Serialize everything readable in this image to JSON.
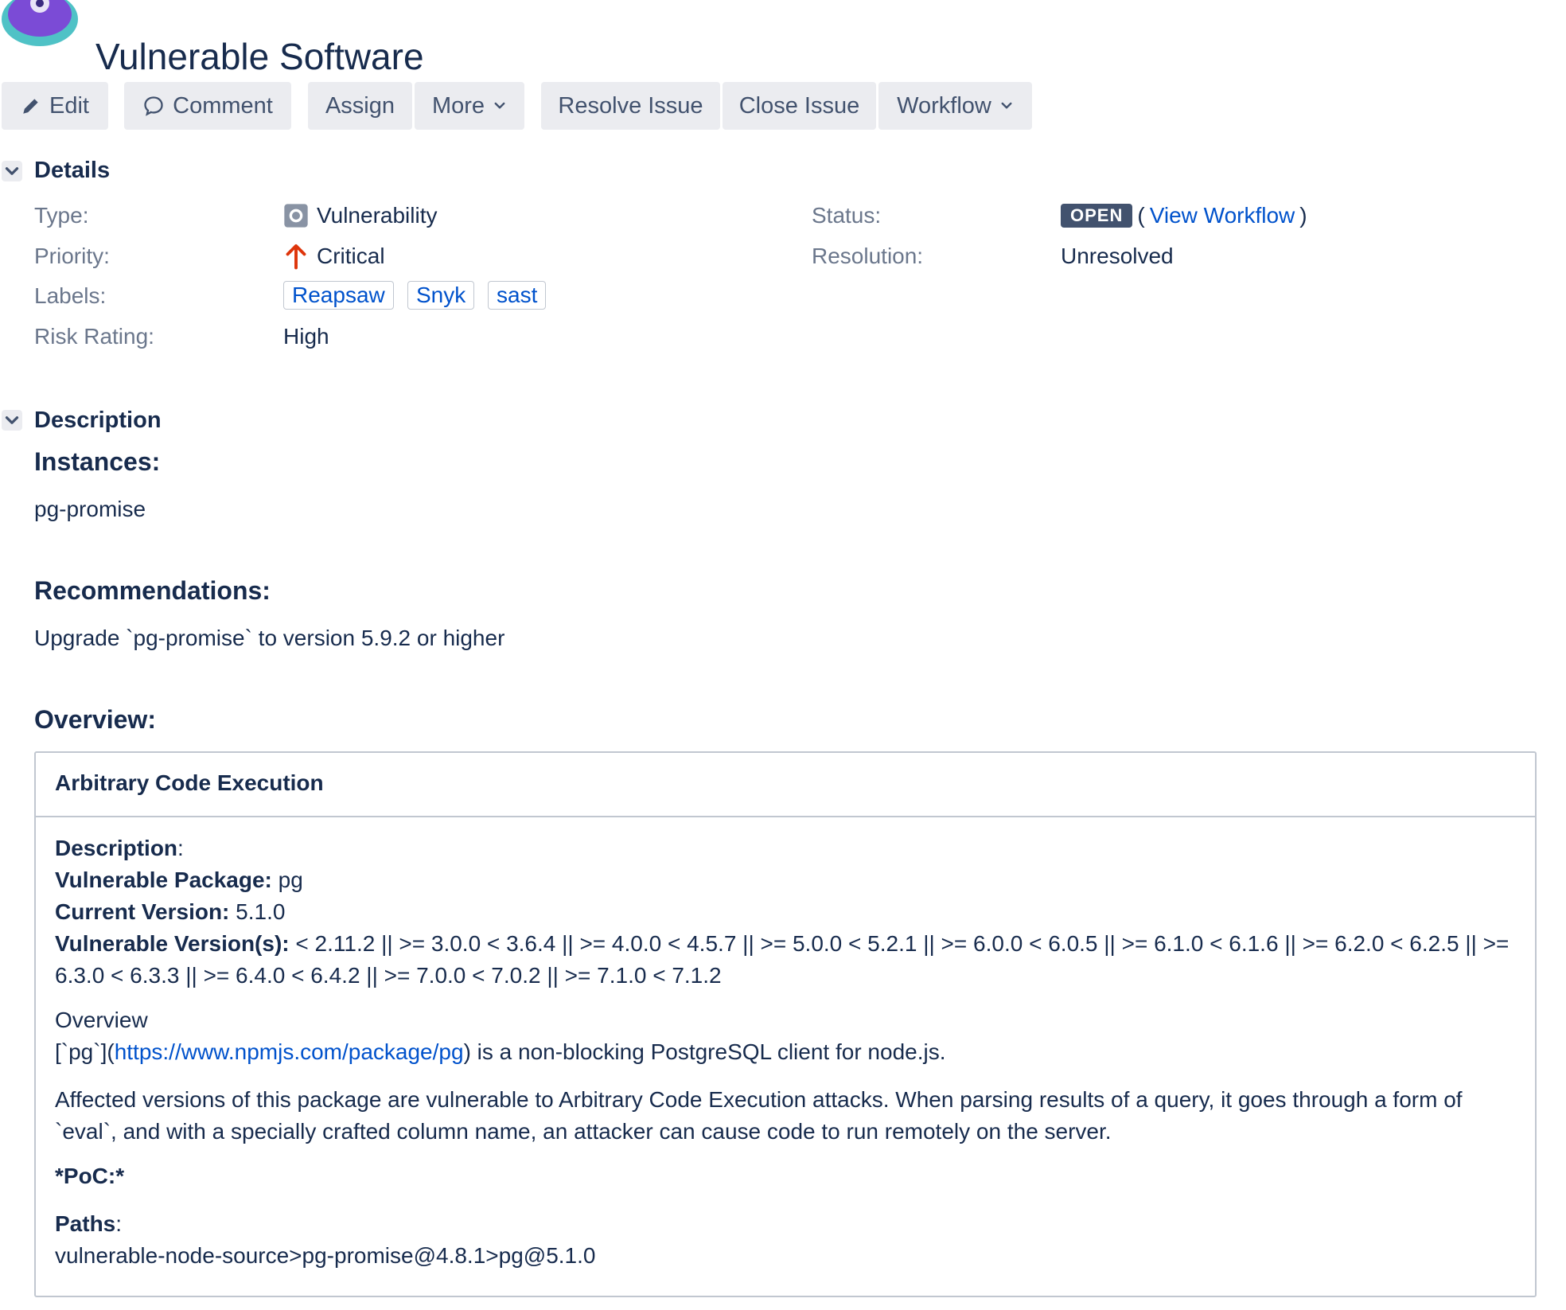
{
  "header": {
    "title": "Vulnerable Software"
  },
  "toolbar": {
    "edit": "Edit",
    "comment": "Comment",
    "assign": "Assign",
    "more": "More",
    "resolve": "Resolve Issue",
    "close": "Close Issue",
    "workflow": "Workflow"
  },
  "details": {
    "heading": "Details",
    "type_label": "Type:",
    "type_value": "Vulnerability",
    "priority_label": "Priority:",
    "priority_value": "Critical",
    "labels_label": "Labels:",
    "labels": [
      "Reapsaw",
      "Snyk",
      "sast"
    ],
    "risk_label": "Risk Rating:",
    "risk_value": "High",
    "status_label": "Status:",
    "status_value": "OPEN",
    "view_workflow": "View Workflow",
    "resolution_label": "Resolution:",
    "resolution_value": "Unresolved"
  },
  "description": {
    "heading": "Description",
    "instances_heading": "Instances:",
    "instances_value": "pg-promise",
    "recommendations_heading": "Recommendations:",
    "recommendations_value": "Upgrade `pg-promise` to version 5.9.2 or higher",
    "overview_heading": "Overview:"
  },
  "panel": {
    "title": "Arbitrary Code Execution",
    "description_label": "Description",
    "description_colon": ":",
    "package_label": "Vulnerable Package:",
    "package_value": "pg",
    "current_label": "Current Version:",
    "current_value": "5.1.0",
    "versions_label": "Vulnerable Version(s):",
    "versions_value": "< 2.11.2 || >= 3.0.0 < 3.6.4 || >= 4.0.0 < 4.5.7 || >= 5.0.0 < 5.2.1 || >= 6.0.0 < 6.0.5 || >= 6.1.0 < 6.1.6 || >= 6.2.0 < 6.2.5 || >= 6.3.0 < 6.3.3 || >= 6.4.0 < 6.4.2 || >= 7.0.0 < 7.0.2 || >= 7.1.0 < 7.1.2",
    "overview_label": "Overview",
    "overview_prefix": "[`pg`](",
    "overview_link": "https://www.npmjs.com/package/pg",
    "overview_suffix": ") is a non-blocking PostgreSQL client for node.js.",
    "affected_text": "Affected versions of this package are vulnerable to Arbitrary Code Execution attacks. When parsing results of a query, it goes through a form of `eval`, and with a specially crafted column name, an attacker can cause code to run remotely on the server.",
    "poc": "*PoC:*",
    "paths_label": "Paths",
    "paths_colon": ":",
    "paths_value": "vulnerable-node-source>pg-promise@4.8.1>pg@5.1.0"
  },
  "colors": {
    "text": "#172b4d",
    "muted": "#6b778c",
    "link": "#0052cc",
    "button_bg": "#ebecf0",
    "lozenge_bg": "#42526e",
    "priority_red": "#de350b",
    "avatar_purple": "#7b4bd6",
    "avatar_teal": "#4fc2c6"
  },
  "icons": {
    "avatar": "bug-monster-avatar",
    "edit": "pencil-icon",
    "comment": "speech-bubble-icon",
    "chevron": "chevron-down-icon",
    "type": "vulnerability-icon",
    "priority": "arrow-up-icon"
  }
}
